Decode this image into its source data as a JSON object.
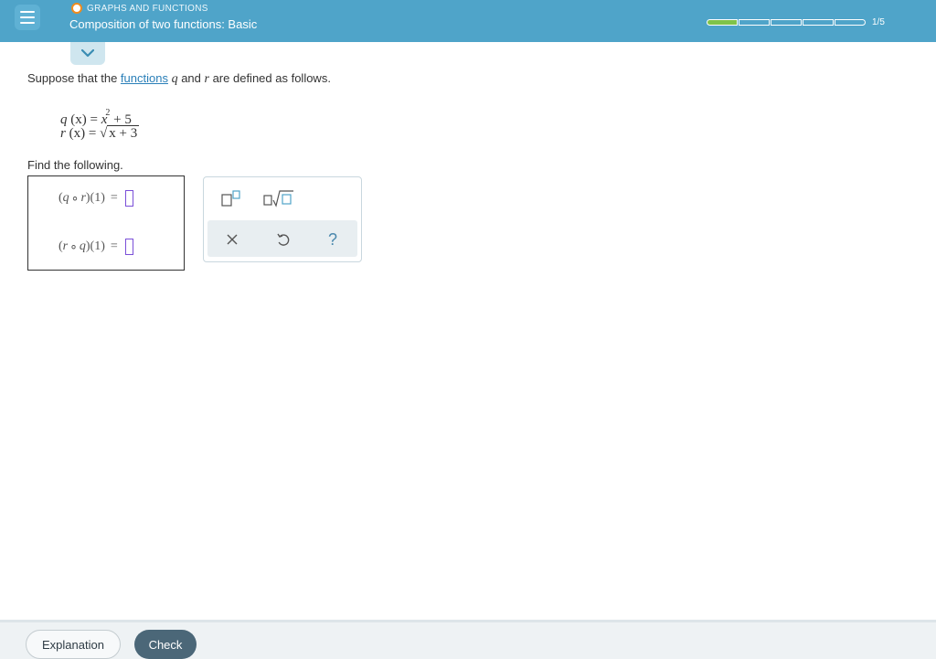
{
  "header": {
    "topic": "GRAPHS AND FUNCTIONS",
    "title": "Composition of two functions: Basic",
    "progress": {
      "completed": 1,
      "total": 5,
      "label": "1/5"
    }
  },
  "colors": {
    "header_bg": "#4fa4c9",
    "accent_orange": "#f08b1d",
    "progress_fill": "#7fc34a",
    "input_border": "#7a4fd8",
    "check_button": "#4b6778"
  },
  "problem": {
    "intro_before": "Suppose that the ",
    "intro_link": "functions",
    "var_q": "q",
    "intro_mid": " and ",
    "var_r": "r",
    "intro_after": " are defined as follows.",
    "def_q_lhs": "q",
    "def_q_arg": "(x)",
    "def_q_eq": " = ",
    "def_q_x": "x",
    "def_q_exp": "2",
    "def_q_rest": " + 5",
    "def_r_lhs": "r",
    "def_r_arg": "(x)",
    "def_r_eq": " = ",
    "def_r_rad": "x + 3",
    "find": "Find the following."
  },
  "answers": [
    {
      "outer": "q",
      "inner": "r",
      "arg": "1",
      "value": ""
    },
    {
      "outer": "r",
      "inner": "q",
      "arg": "1",
      "value": ""
    }
  ],
  "toolbox": {
    "icons": [
      "exponent-icon",
      "sqrt-icon",
      "clear-icon",
      "undo-icon",
      "help-icon"
    ],
    "help_label": "?"
  },
  "footer": {
    "explanation_label": "Explanation",
    "check_label": "Check"
  }
}
